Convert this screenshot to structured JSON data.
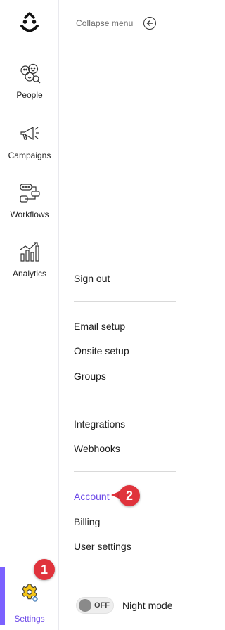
{
  "rail": {
    "items": [
      {
        "label": "People",
        "icon": "people-icon"
      },
      {
        "label": "Campaigns",
        "icon": "megaphone-icon"
      },
      {
        "label": "Workflows",
        "icon": "workflow-icon"
      },
      {
        "label": "Analytics",
        "icon": "analytics-icon"
      }
    ],
    "settings": {
      "label": "Settings",
      "icon": "gear-icon",
      "active": true
    }
  },
  "menu": {
    "collapse_label": "Collapse menu",
    "links": {
      "sign_out": "Sign out",
      "email_setup": "Email setup",
      "onsite_setup": "Onsite setup",
      "groups": "Groups",
      "integrations": "Integrations",
      "webhooks": "Webhooks",
      "account": "Account",
      "billing": "Billing",
      "user_settings": "User settings"
    },
    "active_link": "Account"
  },
  "badges": {
    "one": "1",
    "two": "2"
  },
  "night_mode": {
    "toggle_state": "OFF",
    "label": "Night mode"
  },
  "colors": {
    "accent": "#6d4ae8",
    "active_bar": "#7b61ff",
    "badge": "#e0333c"
  }
}
